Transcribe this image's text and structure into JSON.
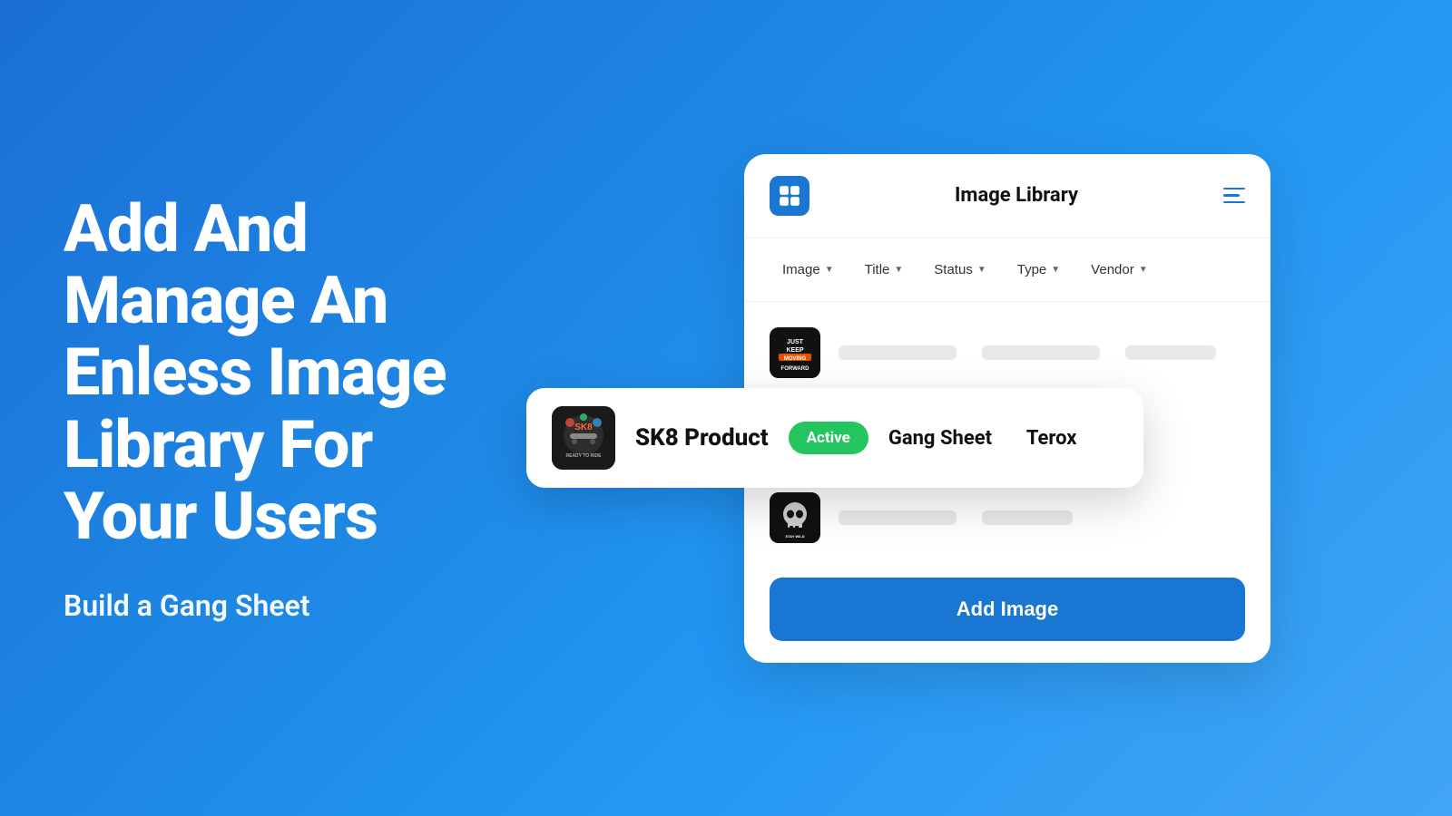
{
  "background": {
    "gradient_start": "#1565c0",
    "gradient_end": "#42a5f5"
  },
  "left": {
    "hero_title": "Add And Manage An Enless Image Library For Your Users",
    "subtitle": "Build a Gang Sheet"
  },
  "panel": {
    "title": "Image Library",
    "logo_alt": "App Logo",
    "menu_icon": "hamburger-menu",
    "filters": [
      {
        "label": "Image",
        "id": "image-filter"
      },
      {
        "label": "Title",
        "id": "title-filter"
      },
      {
        "label": "Status",
        "id": "status-filter"
      },
      {
        "label": "Type",
        "id": "type-filter"
      },
      {
        "label": "Vendor",
        "id": "vendor-filter"
      }
    ],
    "rows": [
      {
        "id": "row-1",
        "image_alt": "Just Keep Forward graphic",
        "has_skeleton": true
      },
      {
        "id": "row-2",
        "image_alt": "Stay Wild And Free skull graphic",
        "has_skeleton": true
      }
    ],
    "add_button_label": "Add Image",
    "featured_row": {
      "image_alt": "SK8 Product sticker graphic",
      "title": "SK8 Product",
      "status": "Active",
      "status_color": "#22c55e",
      "type": "Gang Sheet",
      "vendor": "Terox"
    }
  }
}
